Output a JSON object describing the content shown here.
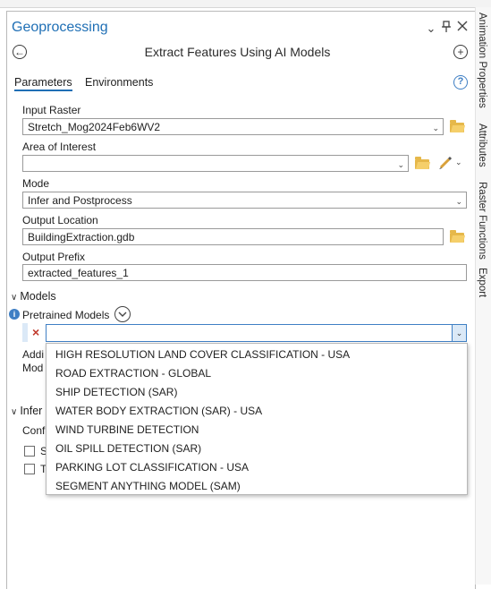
{
  "pane": {
    "title": "Geoprocessing",
    "tool_title": "Extract Features Using AI Models"
  },
  "side_tabs": [
    "Animation Properties",
    "Attributes",
    "Raster Functions",
    "Export"
  ],
  "tabs": [
    {
      "label": "Parameters",
      "active": true
    },
    {
      "label": "Environments",
      "active": false
    }
  ],
  "params": {
    "input_raster": {
      "label": "Input Raster",
      "value": "Stretch_Mog2024Feb6WV2"
    },
    "aoi": {
      "label": "Area of Interest",
      "value": ""
    },
    "mode": {
      "label": "Mode",
      "value": "Infer and Postprocess"
    },
    "output_location": {
      "label": "Output Location",
      "value": "BuildingExtraction.gdb"
    },
    "output_prefix": {
      "label": "Output Prefix",
      "value": "extracted_features_1"
    }
  },
  "models": {
    "section_label": "Models",
    "pretrained_label": "Pretrained Models",
    "remove_glyph": "×",
    "additional_label_1": "Addi",
    "additional_label_2": "Mod"
  },
  "inference": {
    "section_label": "Infer",
    "conf_label": "Conf",
    "check1_label": "S",
    "check2_label": "T"
  },
  "dropdown_options": [
    "HIGH RESOLUTION LAND COVER CLASSIFICATION - USA",
    "ROAD EXTRACTION - GLOBAL",
    "SHIP DETECTION (SAR)",
    "WATER BODY EXTRACTION (SAR) - USA",
    "WIND TURBINE DETECTION",
    "OIL SPILL DETECTION (SAR)",
    "PARKING LOT CLASSIFICATION - USA",
    "SEGMENT ANYTHING MODEL (SAM)"
  ],
  "colors": {
    "accent": "#1f6fb5",
    "folder": "#e6b84a",
    "info": "#3f7fc4",
    "remove": "#c0392b"
  },
  "icons": {
    "help": "?",
    "back": "←",
    "add": "+",
    "pin": "pin-icon",
    "close": "×",
    "menu": "chevron-down-icon"
  }
}
